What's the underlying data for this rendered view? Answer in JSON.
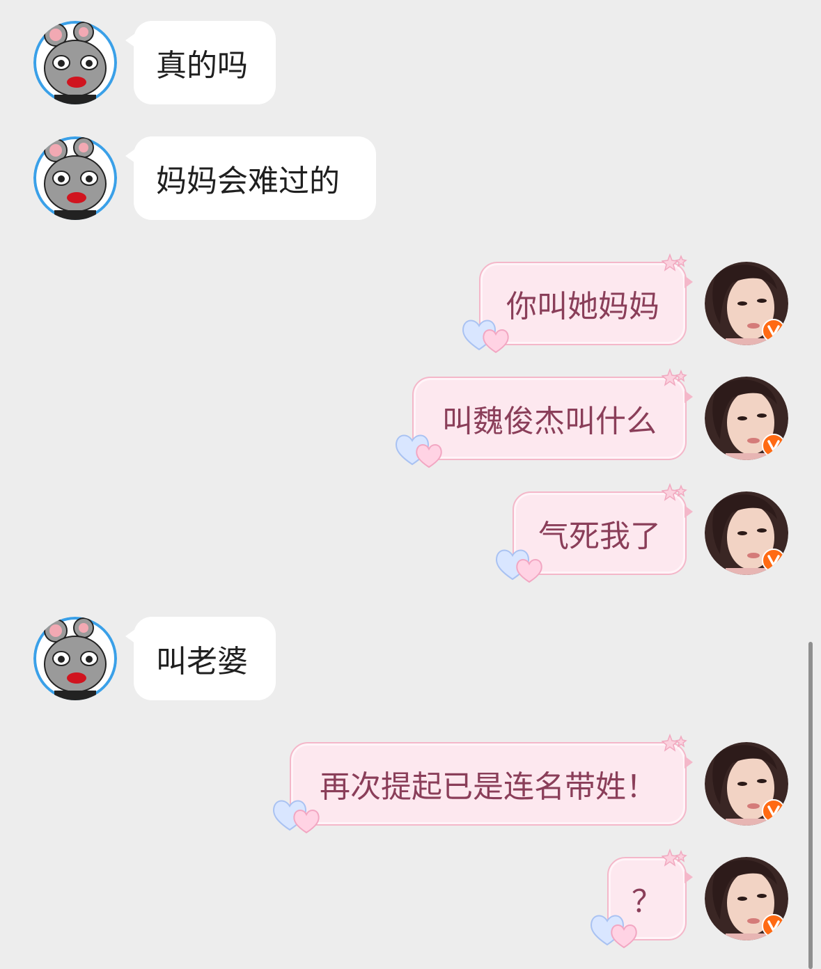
{
  "messages": [
    {
      "side": "left",
      "text": "真的吗"
    },
    {
      "side": "left",
      "text": "妈妈会难过的"
    },
    {
      "side": "right",
      "text": "你叫她妈妈"
    },
    {
      "side": "right",
      "text": "叫魏俊杰叫什么"
    },
    {
      "side": "right",
      "text": "气死我了"
    },
    {
      "side": "left",
      "text": "叫老婆"
    },
    {
      "side": "right",
      "text": "再次提起已是连名带姓！"
    },
    {
      "side": "right",
      "text": "？"
    }
  ],
  "colors": {
    "background": "#ededed",
    "left_bubble": "#ffffff",
    "right_bubble": "#fde8ef",
    "right_bubble_border": "#f4b7c9",
    "right_text": "#8a3e59",
    "verified_badge": "#ff6a13"
  },
  "icons": {
    "left_avatar": "cartoon-mouse-avatar-icon",
    "right_avatar": "user-photo-avatar-icon",
    "badge": "verified-v-badge-icon",
    "bubble_decoration": [
      "star-sparkle-icon",
      "double-heart-icon"
    ]
  }
}
